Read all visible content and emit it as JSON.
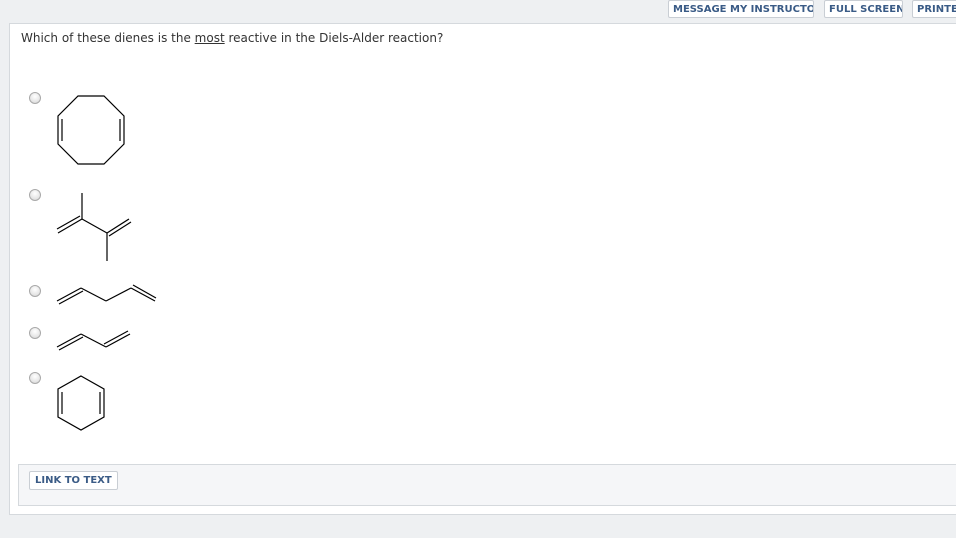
{
  "toolbar": {
    "message_label": "MESSAGE MY INSTRUCTOR",
    "fullscreen_label": "FULL SCREEN",
    "print_label": "PRINTE"
  },
  "question": {
    "before": "Which of these dienes is the ",
    "emphasis": "most",
    "after": " reactive in the Diels-Alder reaction?"
  },
  "options": [
    {
      "structure": "cyclooctadiene-icon",
      "selected": false
    },
    {
      "structure": "dimethylbutadiene-icon",
      "selected": false
    },
    {
      "structure": "pentadiene-icon",
      "selected": false
    },
    {
      "structure": "butadiene-icon",
      "selected": false
    },
    {
      "structure": "cyclohexadiene-icon",
      "selected": false
    }
  ],
  "link_bar": {
    "link_label": "LINK TO TEXT"
  }
}
